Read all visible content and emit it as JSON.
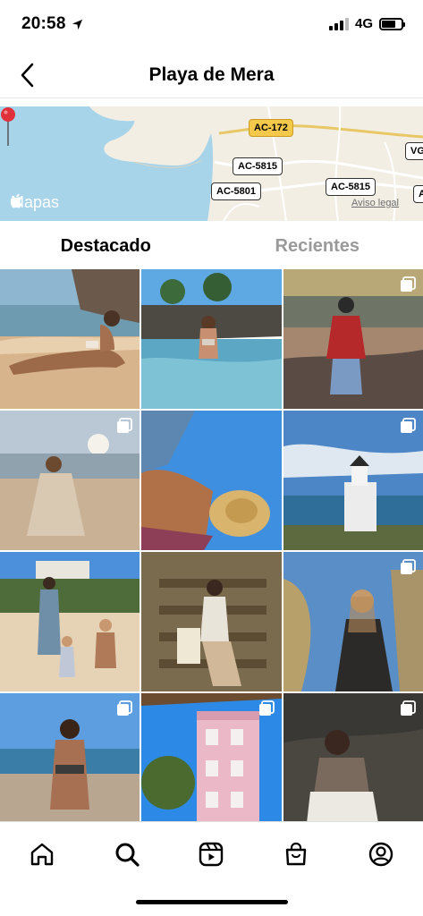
{
  "status_bar": {
    "time": "20:58",
    "network": "4G",
    "battery_level": 0.7
  },
  "header": {
    "title": "Playa de Mera"
  },
  "map": {
    "maps_label": "Mapas",
    "legal_label": "Aviso legal",
    "roads": [
      "AC-172",
      "AC-5815",
      "AC-5801",
      "AC-5815",
      "VG",
      "A"
    ]
  },
  "tabs": [
    {
      "label": "Destacado",
      "active": true
    },
    {
      "label": "Recientes",
      "active": false
    }
  ],
  "grid": {
    "posts": [
      {
        "scene": "beach-woman-lying",
        "multiple": false
      },
      {
        "scene": "woman-in-rockpool",
        "multiple": false
      },
      {
        "scene": "woman-on-rocks-plaid-shirt",
        "multiple": true
      },
      {
        "scene": "woman-sitting-beach-sunset",
        "multiple": true
      },
      {
        "scene": "woman-with-sun-hat",
        "multiple": false
      },
      {
        "scene": "lighthouse",
        "multiple": true
      },
      {
        "scene": "family-on-beach",
        "multiple": false
      },
      {
        "scene": "woman-on-wooden-stairs",
        "multiple": false
      },
      {
        "scene": "woman-black-jacket",
        "multiple": true
      },
      {
        "scene": "woman-in-sea",
        "multiple": true
      },
      {
        "scene": "pink-building",
        "multiple": true
      },
      {
        "scene": "woman-sitting-rocks",
        "multiple": true
      }
    ]
  },
  "bottom_nav": {
    "items": [
      {
        "icon": "home-icon"
      },
      {
        "icon": "search-icon",
        "active": true
      },
      {
        "icon": "reels-icon"
      },
      {
        "icon": "shop-icon"
      },
      {
        "icon": "profile-icon"
      }
    ]
  }
}
